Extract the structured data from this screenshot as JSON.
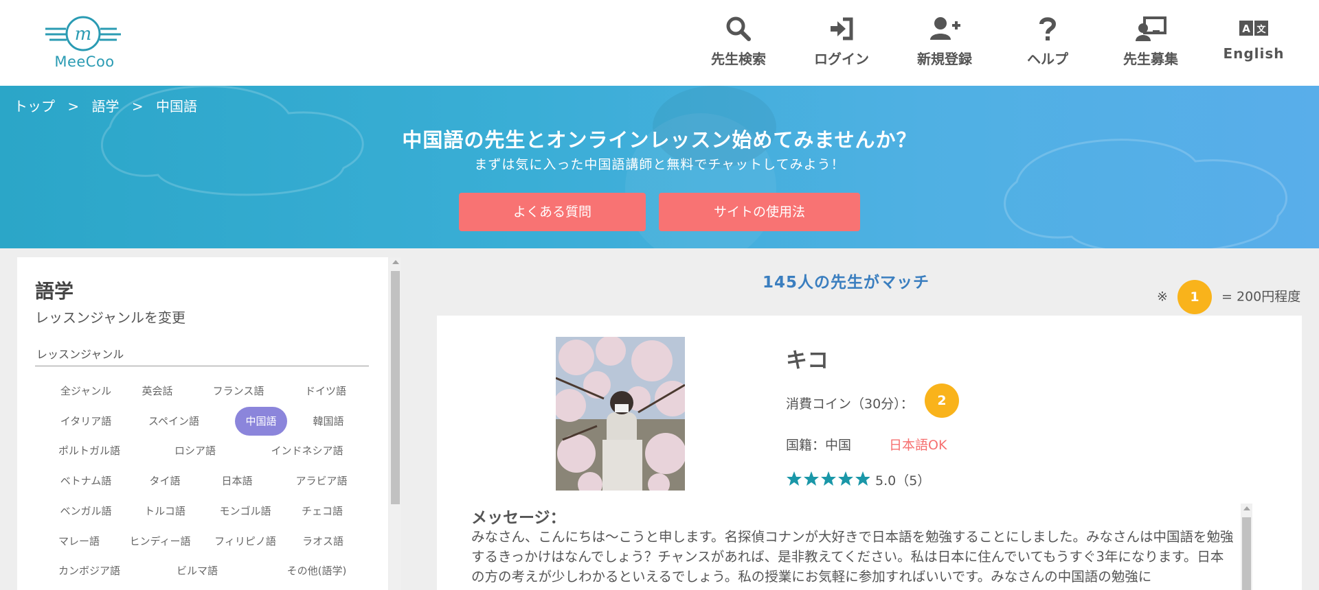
{
  "logo": {
    "text": "MeeCoo",
    "color": "#2a9bb3"
  },
  "nav": [
    {
      "label": "先生検索",
      "icon": "search-icon"
    },
    {
      "label": "ログイン",
      "icon": "login-icon"
    },
    {
      "label": "新規登録",
      "icon": "user-plus-icon"
    },
    {
      "label": "ヘルプ",
      "icon": "question-icon"
    },
    {
      "label": "先生募集",
      "icon": "teacher-board-icon"
    },
    {
      "label": "English",
      "icon": "language-icon"
    }
  ],
  "breadcrumb": [
    "トップ",
    ">",
    "語学",
    ">",
    "中国語"
  ],
  "hero": {
    "title": "中国語の先生とオンラインレッスン始めてみませんか？",
    "subtitle": "まずは気に入った中国語講師と無料でチャットしてみよう！",
    "faq_button": "よくある質問",
    "usage_button": "サイトの使用法"
  },
  "sidebar": {
    "title": "語学",
    "subtitle": "レッスンジャンルを変更",
    "genre_label": "レッスンジャンル",
    "genres": [
      "全ジャンル",
      "英会話",
      "フランス語",
      "ドイツ語",
      "イタリア語",
      "スペイン語",
      "中国語",
      "韓国語",
      "ポルトガル語",
      "ロシア語",
      "インドネシア語",
      "ベトナム語",
      "タイ語",
      "日本語",
      "アラビア語",
      "ベンガル語",
      "トルコ語",
      "モンゴル語",
      "チェコ語",
      "マレー語",
      "ヒンディー語",
      "フィリピノ語",
      "ラオス語",
      "カンボジア語",
      "ビルマ語",
      "その他(語学)"
    ],
    "active_genre": "中国語"
  },
  "results": {
    "match_text": "145人の先生がマッチ",
    "coin_note_prefix": "※",
    "coin_note_value": "1",
    "coin_note_suffix": "= 200円程度"
  },
  "teacher": {
    "name": "キコ",
    "cost_label": "消費コイン（30分）：",
    "coins": "2",
    "nationality": "国籍：中国",
    "japanese": "日本語OK",
    "rating_text": "5.0（5）",
    "stars": 5,
    "message_title": "メッセージ：",
    "message": "みなさん、こんにちは〜こうと申します。名探偵コナンが大好きで日本語を勉強することにしました。みなさんは中国語を勉強するきっかけはなんでしょう？チャンスがあれば、是非教えてください。私は日本に住んでいてもうすぐ3年になります。日本の方の考えが少しわかるといえるでしょう。私の授業にお気軽に参加すればいいです。みなさんの中国語の勉強に"
  },
  "colors": {
    "accent_blue": "#3a7ebf",
    "coin": "#f9b31b",
    "hero_button": "#f87373",
    "active_genre": "#8b85db",
    "star": "#1a97a8"
  }
}
